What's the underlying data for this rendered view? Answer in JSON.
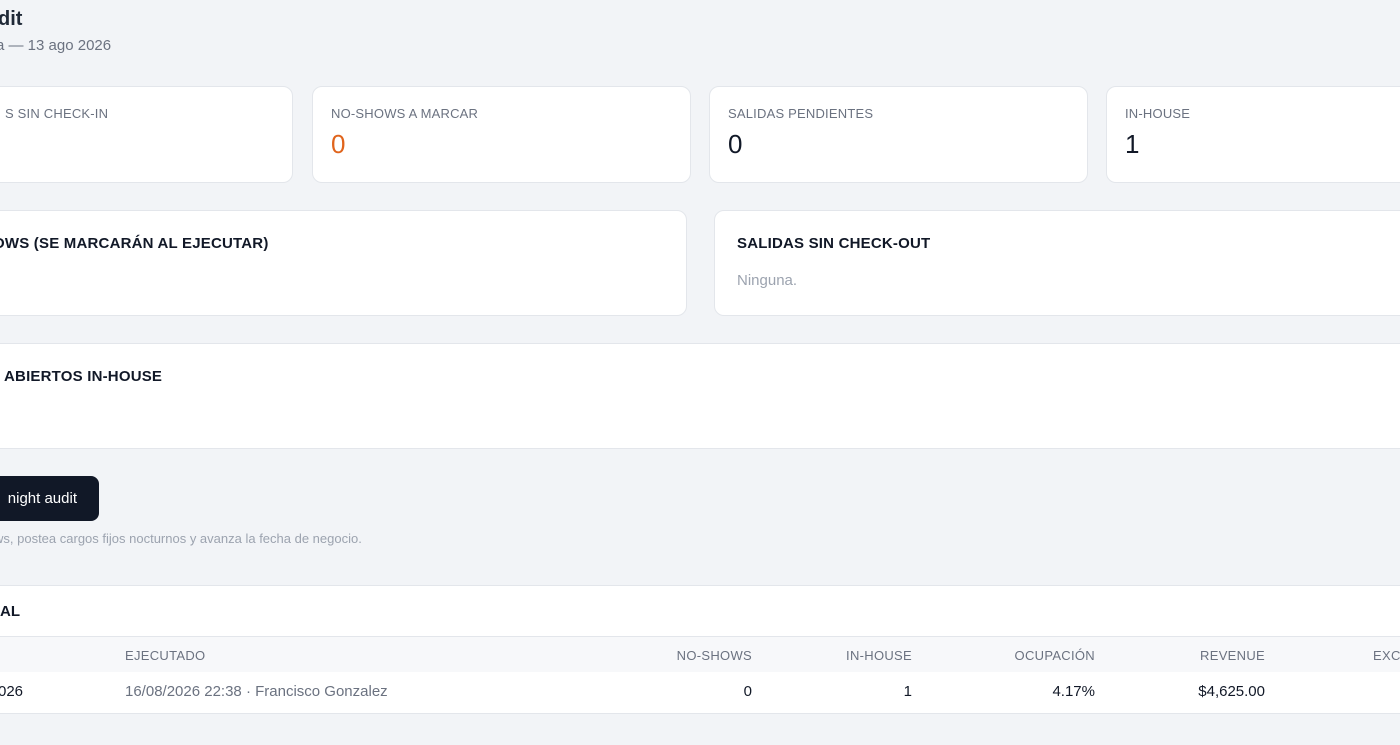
{
  "header": {
    "title": "dit",
    "subtitle": "a — 13 ago 2026"
  },
  "kpis": [
    {
      "label": "S SIN CHECK-IN",
      "value": ""
    },
    {
      "label": "NO-SHOWS A MARCAR",
      "value": "0",
      "accent": "#e0641c"
    },
    {
      "label": "SALIDAS PENDIENTES",
      "value": "0"
    },
    {
      "label": "IN-HOUSE",
      "value": "1"
    }
  ],
  "panels": {
    "noshows": {
      "title": "OWS (SE MARCARÁN AL EJECUTAR)"
    },
    "salidas": {
      "title": "SALIDAS SIN CHECK-OUT",
      "empty_text": "Ninguna."
    },
    "folios": {
      "title": "ABIERTOS IN-HOUSE",
      "empty_text": "."
    }
  },
  "run": {
    "button_label": "night audit",
    "help_text": "ws, postea cargos fijos nocturnos y avanza la fecha de negocio."
  },
  "history": {
    "title": "AL",
    "columns": [
      "",
      "EJECUTADO",
      "NO-SHOWS",
      "IN-HOUSE",
      "OCUPACIÓN",
      "REVENUE",
      "EXC"
    ],
    "rows": [
      {
        "fecha": "026",
        "ejecutado": "16/08/2026 22:38 · Francisco Gonzalez",
        "noshows": "0",
        "inhouse": "1",
        "ocupacion": "4.17%",
        "revenue": "$4,625.00",
        "exc": ""
      }
    ]
  },
  "colors": {
    "background": "#f2f4f7",
    "card": "#ffffff",
    "primary_button": "#111827",
    "accent_orange": "#e0641c"
  }
}
